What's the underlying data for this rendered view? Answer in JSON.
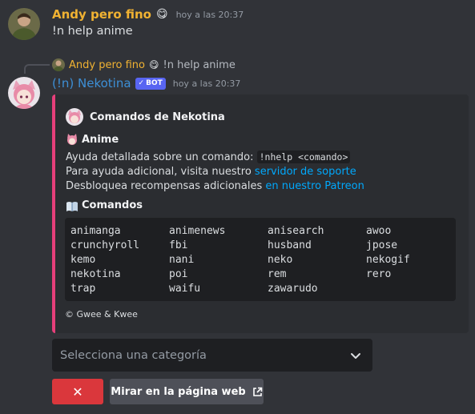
{
  "message1": {
    "author": "Andy pero fino",
    "author_emoji": "😋",
    "timestamp": "hoy a las 20:37",
    "text": "!n help anime"
  },
  "reply_preview": {
    "author": "Andy pero fino",
    "author_emoji": "😋",
    "text": "!n help anime"
  },
  "message2": {
    "author": "(!n) Nekotina",
    "badge": "BOT",
    "timestamp": "hoy a las 20:37",
    "embed": {
      "accent_color": "#e63f7a",
      "author": "Comandos de Nekotina",
      "section_title": "Anime",
      "desc_line1_prefix": "Ayuda detallada sobre un comando: ",
      "desc_line1_code": "!nhelp <comando>",
      "desc_line2_prefix": "Para ayuda adicional, visita nuestro ",
      "desc_line2_link": "servidor de soporte",
      "desc_line3_prefix": "Desbloquea recompensas adicionales ",
      "desc_line3_link": "en nuestro Patreon",
      "commands_title": "Comandos",
      "commands": [
        "animanga",
        "animenews",
        "anisearch",
        "awoo",
        "crunchyroll",
        "fbi",
        "husband",
        "jpose",
        "kemo",
        "nani",
        "neko",
        "nekogif",
        "nekotina",
        "poi",
        "rem",
        "rero",
        "trap",
        "waifu",
        "zawarudo",
        ""
      ],
      "footer": "© Gwee & Kwee"
    }
  },
  "components": {
    "select_placeholder": "Selecciona una categoría",
    "close_button_label": "✕",
    "web_button_label": "Mirar en la página web"
  }
}
